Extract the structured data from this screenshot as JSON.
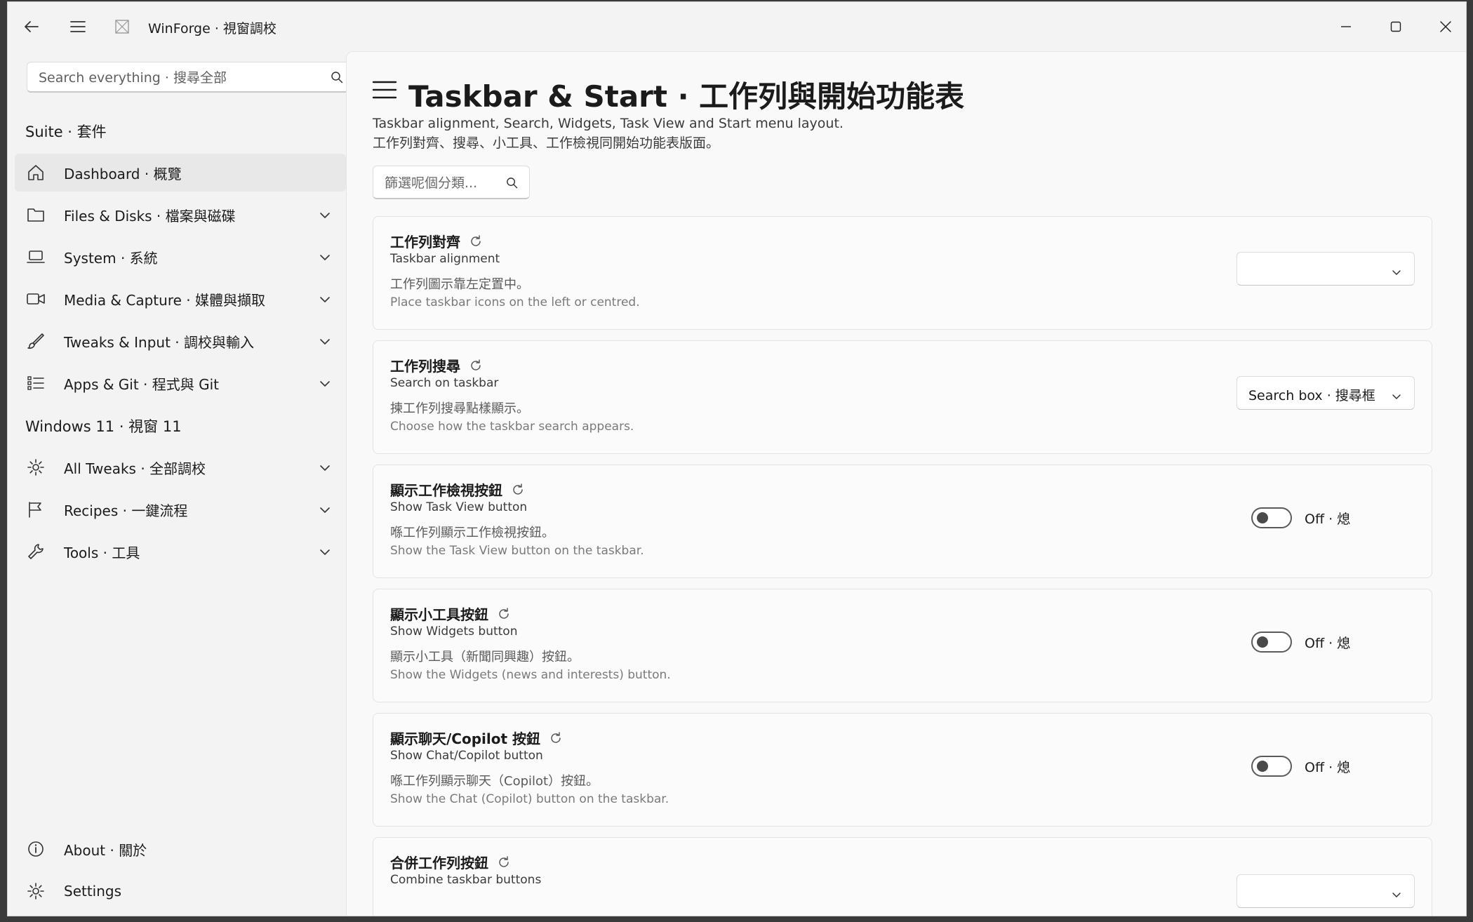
{
  "window": {
    "app_title": "WinForge · 視窗調校"
  },
  "sidebar": {
    "search_placeholder": "Search everything · 搜尋全部",
    "section_suite": "Suite · 套件",
    "section_windows": "Windows 11 · 視窗 11",
    "items": [
      {
        "label": "Dashboard · 概覽",
        "icon": "home-icon"
      },
      {
        "label": "Files & Disks · 檔案與磁碟",
        "icon": "folder-icon"
      },
      {
        "label": "System · 系統",
        "icon": "laptop-icon"
      },
      {
        "label": "Media & Capture · 媒體與擷取",
        "icon": "video-camera-icon"
      },
      {
        "label": "Tweaks & Input · 調校與輸入",
        "icon": "brush-icon"
      },
      {
        "label": "Apps & Git · 程式與 Git",
        "icon": "list-icon"
      },
      {
        "label": "All Tweaks · 全部調校",
        "icon": "gear-icon"
      },
      {
        "label": "Recipes · 一鍵流程",
        "icon": "flag-icon"
      },
      {
        "label": "Tools · 工具",
        "icon": "wrench-icon"
      }
    ],
    "footer": [
      {
        "label": "About · 關於",
        "icon": "info-icon"
      },
      {
        "label": "Settings",
        "icon": "gear-icon"
      }
    ]
  },
  "main": {
    "title": "Taskbar & Start · 工作列與開始功能表",
    "desc_en": "Taskbar alignment, Search, Widgets, Task View and Start menu layout.",
    "desc_zh": "工作列對齊、搜尋、小工具、工作檢視同開始功能表版面。",
    "filter_placeholder": "篩選呢個分類...",
    "cards": [
      {
        "title": "工作列對齊",
        "subtitle": "Taskbar alignment",
        "desc_zh": "工作列圖示靠左定置中。",
        "desc_en": "Place taskbar icons on the left or centred.",
        "control": "combo",
        "value": ""
      },
      {
        "title": "工作列搜尋",
        "subtitle": "Search on taskbar",
        "desc_zh": "揀工作列搜尋點樣顯示。",
        "desc_en": "Choose how the taskbar search appears.",
        "control": "combo",
        "value": "Search box · 搜尋框"
      },
      {
        "title": "顯示工作檢視按鈕",
        "subtitle": "Show Task View button",
        "desc_zh": "喺工作列顯示工作檢視按鈕。",
        "desc_en": "Show the Task View button on the taskbar.",
        "control": "toggle",
        "value": "Off · 熄"
      },
      {
        "title": "顯示小工具按鈕",
        "subtitle": "Show Widgets button",
        "desc_zh": "顯示小工具（新聞同興趣）按鈕。",
        "desc_en": "Show the Widgets (news and interests) button.",
        "control": "toggle",
        "value": "Off · 熄"
      },
      {
        "title": "顯示聊天/Copilot 按鈕",
        "subtitle": "Show Chat/Copilot button",
        "desc_zh": "喺工作列顯示聊天（Copilot）按鈕。",
        "desc_en": "Show the Chat (Copilot) button on the taskbar.",
        "control": "toggle",
        "value": "Off · 熄"
      },
      {
        "title": "合併工作列按鈕",
        "subtitle": "Combine taskbar buttons",
        "desc_zh": "",
        "desc_en": "",
        "control": "combo",
        "value": ""
      }
    ]
  }
}
